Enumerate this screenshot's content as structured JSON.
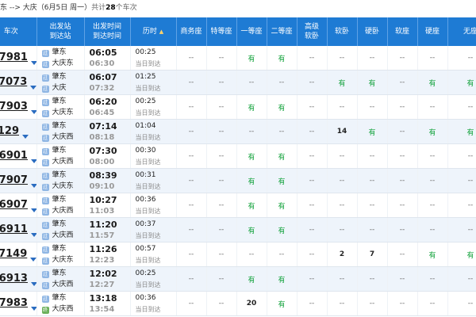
{
  "route": {
    "from": "东",
    "arrow": " --> ",
    "to": "大庆",
    "date": "（6月5日  周一）",
    "count_prefix": "共计",
    "count": "28",
    "count_suffix": "个车次"
  },
  "headers": [
    {
      "l1": "车次",
      "l2": ""
    },
    {
      "l1": "出发站",
      "l2": "到达站"
    },
    {
      "l1": "出发时间",
      "l2": "到达时间"
    },
    {
      "l1": "历时",
      "l2": "",
      "sort": "▲"
    },
    {
      "l1": "商务座",
      "l2": ""
    },
    {
      "l1": "特等座",
      "l2": ""
    },
    {
      "l1": "一等座",
      "l2": ""
    },
    {
      "l1": "二等座",
      "l2": ""
    },
    {
      "l1": "高级",
      "l2": "软卧"
    },
    {
      "l1": "软卧",
      "l2": ""
    },
    {
      "l1": "硬卧",
      "l2": ""
    },
    {
      "l1": "软座",
      "l2": ""
    },
    {
      "l1": "硬座",
      "l2": ""
    },
    {
      "l1": "无座",
      "l2": ""
    }
  ],
  "colors": {
    "header_bg": "#1e7bd4",
    "available": "#13a23c",
    "row_alt": "#eef4fb"
  },
  "icons": {
    "start_badge": "始",
    "pass_badge": "过",
    "end_badge": "终"
  },
  "rows": [
    {
      "no": "D7981",
      "from": "肇东",
      "to": "大庆东",
      "dep": "06:05",
      "arr": "06:30",
      "dur": "00:25",
      "day": "当日到达",
      "seats": [
        "--",
        "--",
        "有",
        "有",
        "--",
        "--",
        "--",
        "--",
        "--",
        "--"
      ]
    },
    {
      "no": "K7073",
      "from": "肇东",
      "to": "大庆",
      "dep": "06:07",
      "arr": "07:32",
      "dur": "01:25",
      "day": "当日到达",
      "seats": [
        "--",
        "--",
        "--",
        "--",
        "--",
        "有",
        "有",
        "--",
        "有",
        "有"
      ]
    },
    {
      "no": "D7903",
      "from": "肇东",
      "to": "大庆东",
      "dep": "06:20",
      "arr": "06:45",
      "dur": "00:25",
      "day": "当日到达",
      "seats": [
        "--",
        "--",
        "有",
        "有",
        "--",
        "--",
        "--",
        "--",
        "--",
        "--"
      ]
    },
    {
      "no": "T129",
      "from": "肇东",
      "to": "大庆西",
      "dep": "07:14",
      "arr": "08:18",
      "dur": "01:04",
      "day": "当日到达",
      "seats": [
        "--",
        "--",
        "--",
        "--",
        "--",
        "14",
        "有",
        "--",
        "有",
        "有"
      ]
    },
    {
      "no": "D6901",
      "from": "肇东",
      "to": "大庆西",
      "dep": "07:30",
      "arr": "08:00",
      "dur": "00:30",
      "day": "当日到达",
      "seats": [
        "--",
        "--",
        "有",
        "有",
        "--",
        "--",
        "--",
        "--",
        "--",
        "--"
      ]
    },
    {
      "no": "D7907",
      "from": "肇东",
      "to": "大庆东",
      "dep": "08:39",
      "arr": "09:10",
      "dur": "00:31",
      "day": "当日到达",
      "seats": [
        "--",
        "--",
        "有",
        "有",
        "--",
        "--",
        "--",
        "--",
        "--",
        "--"
      ]
    },
    {
      "no": "D6907",
      "from": "肇东",
      "to": "大庆西",
      "dep": "10:27",
      "arr": "11:03",
      "dur": "00:36",
      "day": "当日到达",
      "seats": [
        "--",
        "--",
        "有",
        "有",
        "--",
        "--",
        "--",
        "--",
        "--",
        "--"
      ]
    },
    {
      "no": "D6911",
      "from": "肇东",
      "to": "大庆西",
      "dep": "11:20",
      "arr": "11:57",
      "dur": "00:37",
      "day": "当日到达",
      "seats": [
        "--",
        "--",
        "有",
        "有",
        "--",
        "--",
        "--",
        "--",
        "--",
        "--"
      ]
    },
    {
      "no": "K7149",
      "from": "肇东",
      "to": "大庆东",
      "dep": "11:26",
      "arr": "12:23",
      "dur": "00:57",
      "day": "当日到达",
      "seats": [
        "--",
        "--",
        "--",
        "--",
        "--",
        "2",
        "7",
        "--",
        "有",
        "有"
      ]
    },
    {
      "no": "D6913",
      "from": "肇东",
      "to": "大庆西",
      "dep": "12:02",
      "arr": "12:27",
      "dur": "00:25",
      "day": "当日到达",
      "seats": [
        "--",
        "--",
        "有",
        "有",
        "--",
        "--",
        "--",
        "--",
        "--",
        "--"
      ]
    },
    {
      "no": "D7983",
      "from": "肇东",
      "to": "大庆西",
      "dep": "13:18",
      "arr": "13:54",
      "dur": "00:36",
      "day": "当日到达",
      "seats": [
        "--",
        "--",
        "20",
        "有",
        "--",
        "--",
        "--",
        "--",
        "--",
        "--"
      ]
    }
  ]
}
